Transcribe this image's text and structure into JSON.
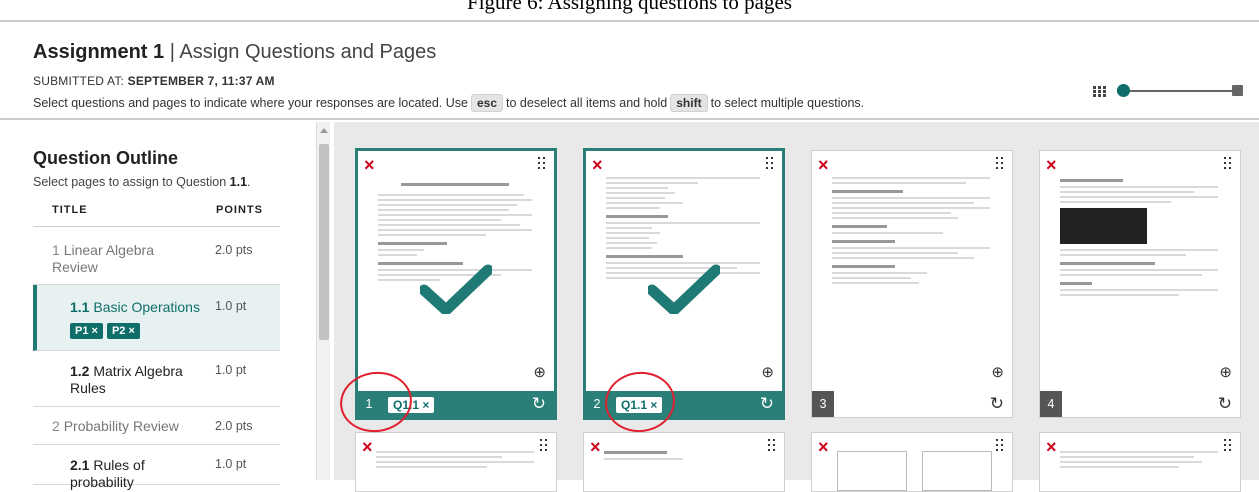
{
  "caption": "Figure 6: Assigning questions to pages",
  "header": {
    "title": "Assignment 1",
    "subtitle": "Assign Questions and Pages",
    "separator": " | ",
    "submitted_label": "SUBMITTED AT:",
    "submitted_value": "SEPTEMBER 7, 11:37 AM",
    "instr_1": "Select questions and pages to indicate where your responses are located. Use",
    "key_esc": "esc",
    "instr_2": "to deselect all items and hold",
    "key_shift": "shift",
    "instr_3": "to select multiple questions.",
    "zoom_level": 0.05
  },
  "outline": {
    "title": "Question Outline",
    "sub_prefix": "Select pages to assign to Question ",
    "sub_q": "1.1",
    "sub_suffix": ".",
    "col_title": "TITLE",
    "col_points": "POINTS",
    "rows": [
      {
        "num": "1",
        "name": "Linear Algebra Review",
        "pts": "2.0 pts"
      },
      {
        "num": "1.1",
        "name": "Basic Operations",
        "pts": "1.0 pt",
        "tags": [
          "P1 ×",
          "P2 ×"
        ]
      },
      {
        "num": "1.2",
        "name": "Matrix Algebra Rules",
        "pts": "1.0 pt"
      },
      {
        "num": "2",
        "name": "Probability Review",
        "pts": "2.0 pts"
      },
      {
        "num": "2.1",
        "name": "Rules of probability",
        "pts": "1.0 pt"
      }
    ]
  },
  "pages": [
    {
      "num": "1",
      "tag": "Q1.1 ×",
      "selected": true
    },
    {
      "num": "2",
      "tag": "Q1.1 ×",
      "selected": true
    },
    {
      "num": "3",
      "tag": "",
      "selected": false
    },
    {
      "num": "4",
      "tag": "",
      "selected": false
    }
  ],
  "icons": {
    "delete": "×",
    "rotate": "↻",
    "zoom": "⊕"
  },
  "colors": {
    "accent": "#0f6e6a",
    "delete": "#d0021b",
    "annotation": "#e0202e"
  }
}
